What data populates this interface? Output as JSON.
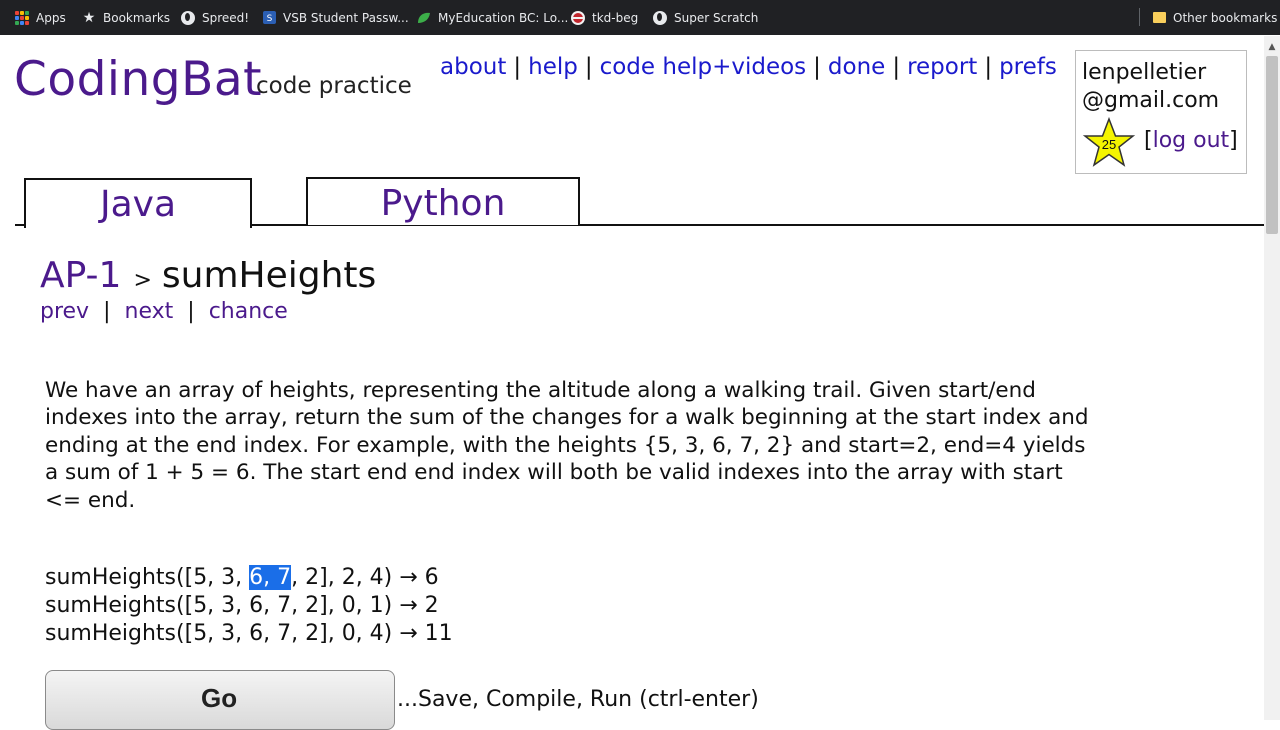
{
  "bookmarks": {
    "items": [
      {
        "label": "Apps",
        "icon": "apps-grid-icon"
      },
      {
        "label": "Bookmarks",
        "icon": "star-icon"
      },
      {
        "label": "Spreed!",
        "icon": "globe-icon"
      },
      {
        "label": "VSB Student Passw...",
        "icon": "vsb-icon"
      },
      {
        "label": "MyEducation BC: Lo...",
        "icon": "leaf-icon"
      },
      {
        "label": "tkd-beg",
        "icon": "tkd-icon"
      },
      {
        "label": "Super Scratch",
        "icon": "globe-icon"
      }
    ],
    "other": "Other bookmarks"
  },
  "header": {
    "logo": "CodingBat",
    "logo_sub": "code practice",
    "nav": [
      "about",
      "help",
      "code help+videos",
      "done",
      "report",
      "prefs"
    ],
    "nav_sep": "|"
  },
  "user": {
    "email_line1": "lenpelletier",
    "email_line2": "@gmail.com",
    "star_count": "25",
    "logout": "log out",
    "bracket_open": "[",
    "bracket_close": "]"
  },
  "tabs": [
    {
      "label": "Java",
      "active": true
    },
    {
      "label": "Python",
      "active": false
    }
  ],
  "problem": {
    "section": "AP-1",
    "arrow": ">",
    "title": "sumHeights",
    "prev": "prev",
    "next": "next",
    "chance": "chance",
    "sep": "|",
    "description": "We have an array of heights, representing the altitude along a walking trail. Given start/end indexes into the array, return the sum of the changes for a walk beginning at the start index and ending at the end index. For example, with the heights {5, 3, 6, 7, 2} and start=2, end=4 yields a sum of 1 + 5 = 6. The start end end index will both be valid indexes into the array with start <= end.",
    "examples": [
      {
        "pre": "sumHeights([5, 3, ",
        "highlight": "6, 7",
        "post": ", 2], 2, 4) → 6"
      },
      {
        "pre": "sumHeights([5, 3, 6, 7, 2], 0, 1) → 2",
        "highlight": "",
        "post": ""
      },
      {
        "pre": "sumHeights([5, 3, 6, 7, 2], 0, 4) → 11",
        "highlight": "",
        "post": ""
      }
    ],
    "go_label": "Go",
    "run_hint": "...Save, Compile, Run (ctrl-enter)"
  },
  "colors": {
    "brand_purple": "#4b1a8c",
    "link_blue": "#1a1acc",
    "selection": "#1a6ee8",
    "star_yellow": "#f4f400"
  }
}
